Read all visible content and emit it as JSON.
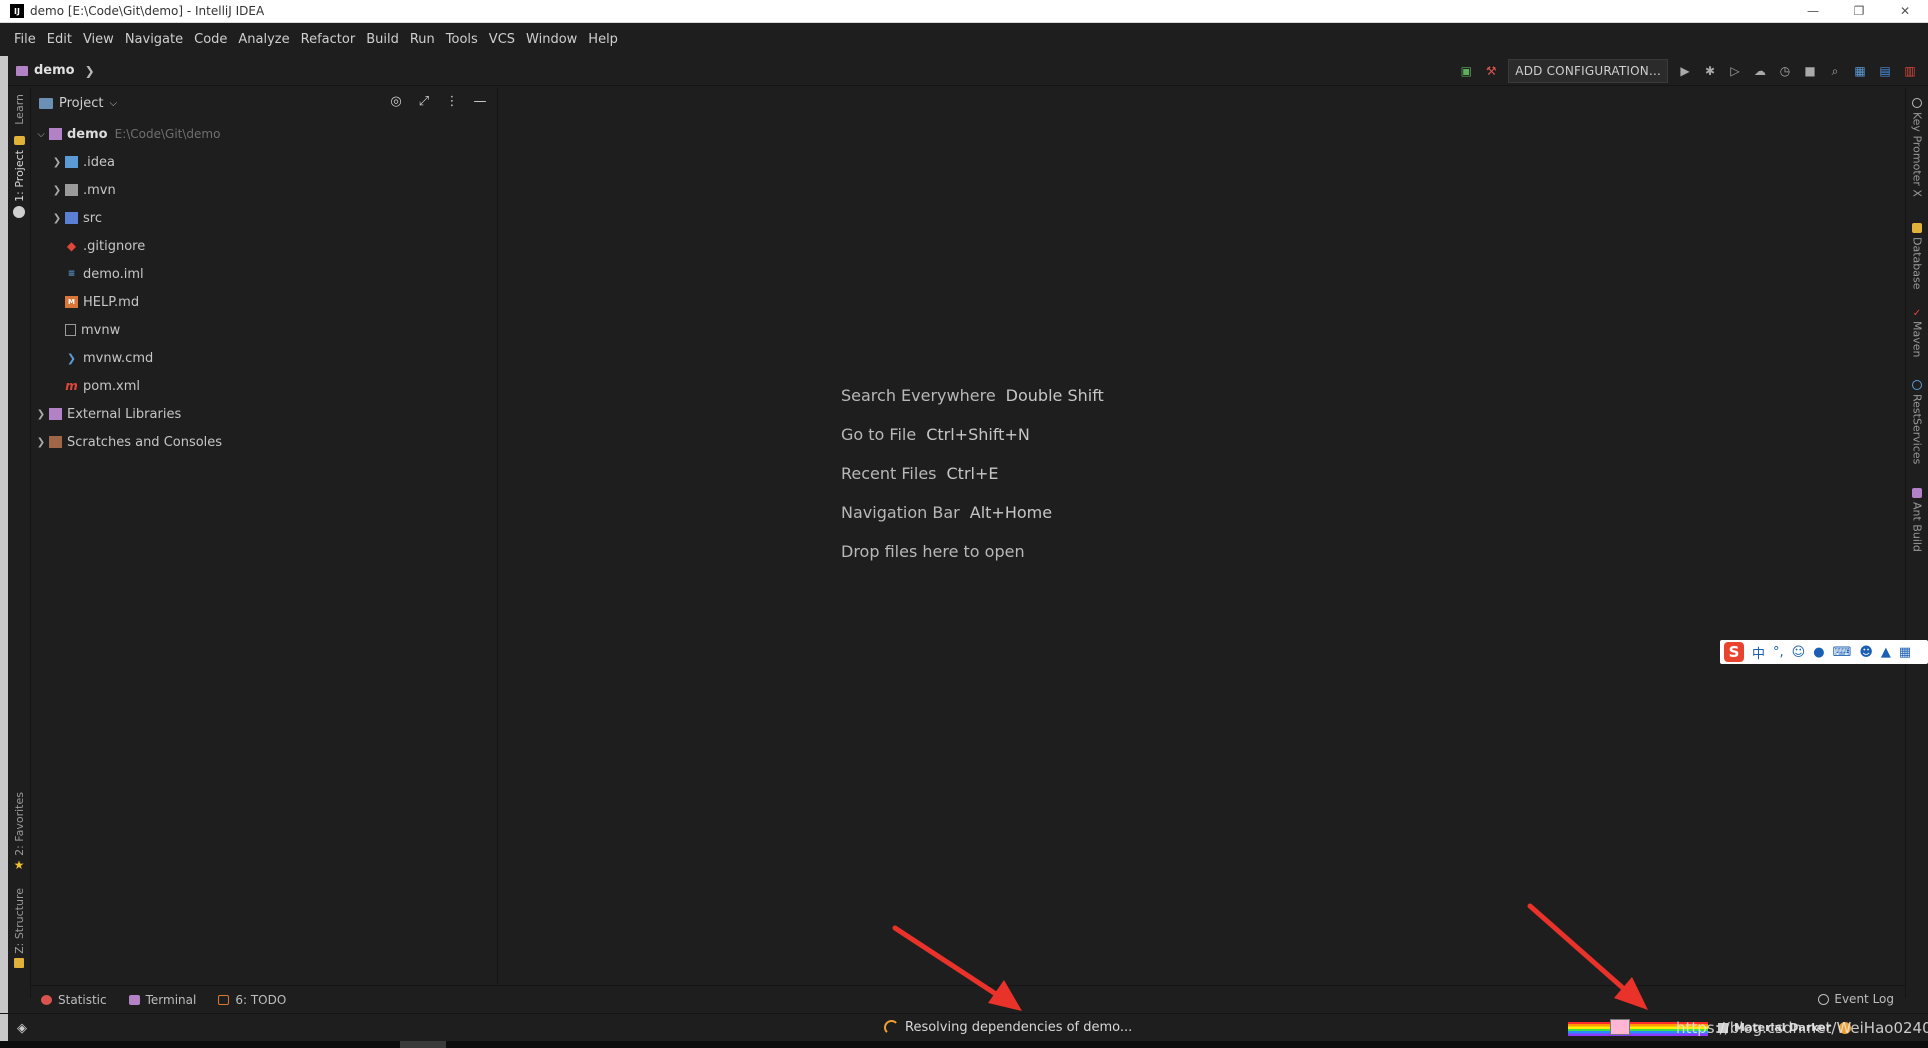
{
  "window": {
    "title": "demo [E:\\Code\\Git\\demo] - IntelliJ IDEA",
    "app_icon": "intellij-icon",
    "controls": [
      "—",
      "❐",
      "✕"
    ]
  },
  "menu": [
    "File",
    "Edit",
    "View",
    "Navigate",
    "Code",
    "Analyze",
    "Refactor",
    "Build",
    "Run",
    "Tools",
    "VCS",
    "Window",
    "Help"
  ],
  "navbar": {
    "breadcrumb": "demo",
    "add_configuration": "ADD CONFIGURATION..."
  },
  "left_tabs": {
    "learn": "Learn",
    "project": "1: Project",
    "favorites": "2: Favorites",
    "structure": "Z: Structure"
  },
  "right_tabs": {
    "key_promoter": "Key Promoter X",
    "database": "Database",
    "maven": "Maven",
    "rest": "RestServices",
    "ant": "Ant Build"
  },
  "project_panel": {
    "title": "Project",
    "root": {
      "name": "demo",
      "path": "E:\\Code\\Git\\demo"
    },
    "items": [
      {
        "name": ".idea",
        "expandable": true
      },
      {
        "name": ".mvn",
        "expandable": true
      },
      {
        "name": "src",
        "expandable": true
      },
      {
        "name": ".gitignore",
        "expandable": false
      },
      {
        "name": "demo.iml",
        "expandable": false
      },
      {
        "name": "HELP.md",
        "expandable": false
      },
      {
        "name": "mvnw",
        "expandable": false
      },
      {
        "name": "mvnw.cmd",
        "expandable": false
      },
      {
        "name": "pom.xml",
        "expandable": false
      }
    ],
    "external": "External Libraries",
    "scratches": "Scratches and Consoles"
  },
  "editor_hints": [
    {
      "label": "Search Everywhere",
      "key": "Double Shift"
    },
    {
      "label": "Go to File",
      "key": "Ctrl+Shift+N"
    },
    {
      "label": "Recent Files",
      "key": "Ctrl+E"
    },
    {
      "label": "Navigation Bar",
      "key": "Alt+Home"
    },
    {
      "label": "Drop files here to open",
      "key": ""
    }
  ],
  "ime": {
    "logo": "S",
    "mode": "中"
  },
  "bottom_tabs": {
    "statistic": "Statistic",
    "terminal": "Terminal",
    "todo": "6: TODO",
    "event_log": "Event Log"
  },
  "status": {
    "message": "Resolving dependencies of demo...",
    "theme": "Material Darker",
    "watermark": "https://blog.csdn.net/WeiHao0240"
  },
  "colors": {
    "background": "#1e1e1e",
    "arrow": "#e8322a",
    "accent_orange": "#f0a030"
  }
}
